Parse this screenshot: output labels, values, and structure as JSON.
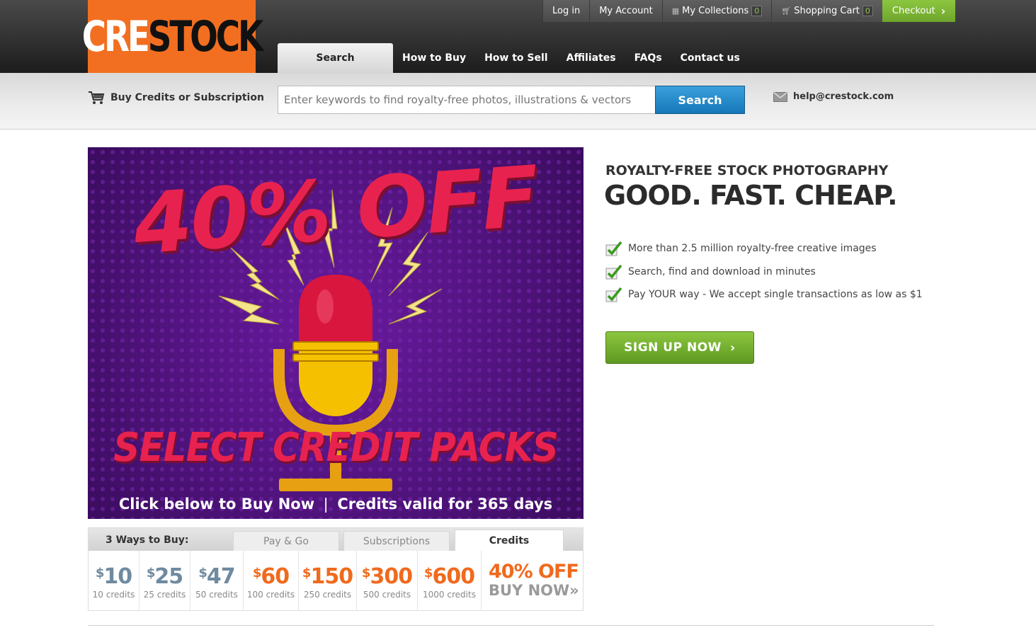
{
  "logo": {
    "part1": "CRE",
    "part2": "STOCK"
  },
  "topbar": {
    "login": "Log in",
    "account": "My Account",
    "collections": "My Collections",
    "collections_count": "0",
    "cart": "Shopping Cart",
    "cart_count": "0",
    "checkout": "Checkout",
    "checkout_arrow": "›"
  },
  "nav": {
    "search_tab": "Search",
    "items": [
      "How to Buy",
      "How to Sell",
      "Affiliates",
      "FAQs",
      "Contact us"
    ]
  },
  "search": {
    "buy_credits": "Buy Credits or Subscription",
    "placeholder": "Enter keywords to find royalty-free photos, illustrations & vectors",
    "button": "Search",
    "help_email": "help@crestock.com"
  },
  "banner": {
    "headline": "40% OFF",
    "subline": "SELECT CREDIT PACKS",
    "footer": "Click below to Buy Now  ❘  Credits valid for 365 days"
  },
  "ways": {
    "label": "3 Ways to Buy:",
    "tabs": [
      "Pay & Go",
      "Subscriptions",
      "Credits"
    ],
    "active_tab": "Credits",
    "prices": [
      {
        "currency": "$",
        "amount": "10",
        "credits": "10 credits",
        "color": "blue"
      },
      {
        "currency": "$",
        "amount": "25",
        "credits": "25 credits",
        "color": "blue"
      },
      {
        "currency": "$",
        "amount": "47",
        "credits": "50 credits",
        "color": "blue"
      },
      {
        "currency": "$",
        "amount": "60",
        "credits": "100 credits",
        "color": "orange"
      },
      {
        "currency": "$",
        "amount": "150",
        "credits": "250 credits",
        "color": "orange"
      },
      {
        "currency": "$",
        "amount": "300",
        "credits": "500 credits",
        "color": "orange"
      },
      {
        "currency": "$",
        "amount": "600",
        "credits": "1000 credits",
        "color": "orange"
      }
    ],
    "deal_off": "40% OFF",
    "deal_buy": "BUY NOW",
    "deal_arrows": "»"
  },
  "pitch": {
    "sub": "ROYALTY-FREE STOCK PHOTOGRAPHY",
    "main": "GOOD. FAST. CHEAP.",
    "bullets": [
      "More than 2.5 million royalty-free creative images",
      "Search, find and download in minutes",
      "Pay YOUR way - We accept single transactions as low as $1"
    ],
    "signup": "SIGN UP NOW",
    "signup_arrow": "›"
  },
  "colors": {
    "brand_orange": "#f26f21",
    "accent_green": "#8cc63f",
    "search_blue": "#1677b8",
    "banner_purple": "#4e137a",
    "banner_red": "#e8224f"
  },
  "icons": [
    "cart-icon",
    "mail-icon",
    "checkmark-icon",
    "collections-icon",
    "shopping-cart-icon",
    "microphone-icon",
    "lightning-icon"
  ]
}
